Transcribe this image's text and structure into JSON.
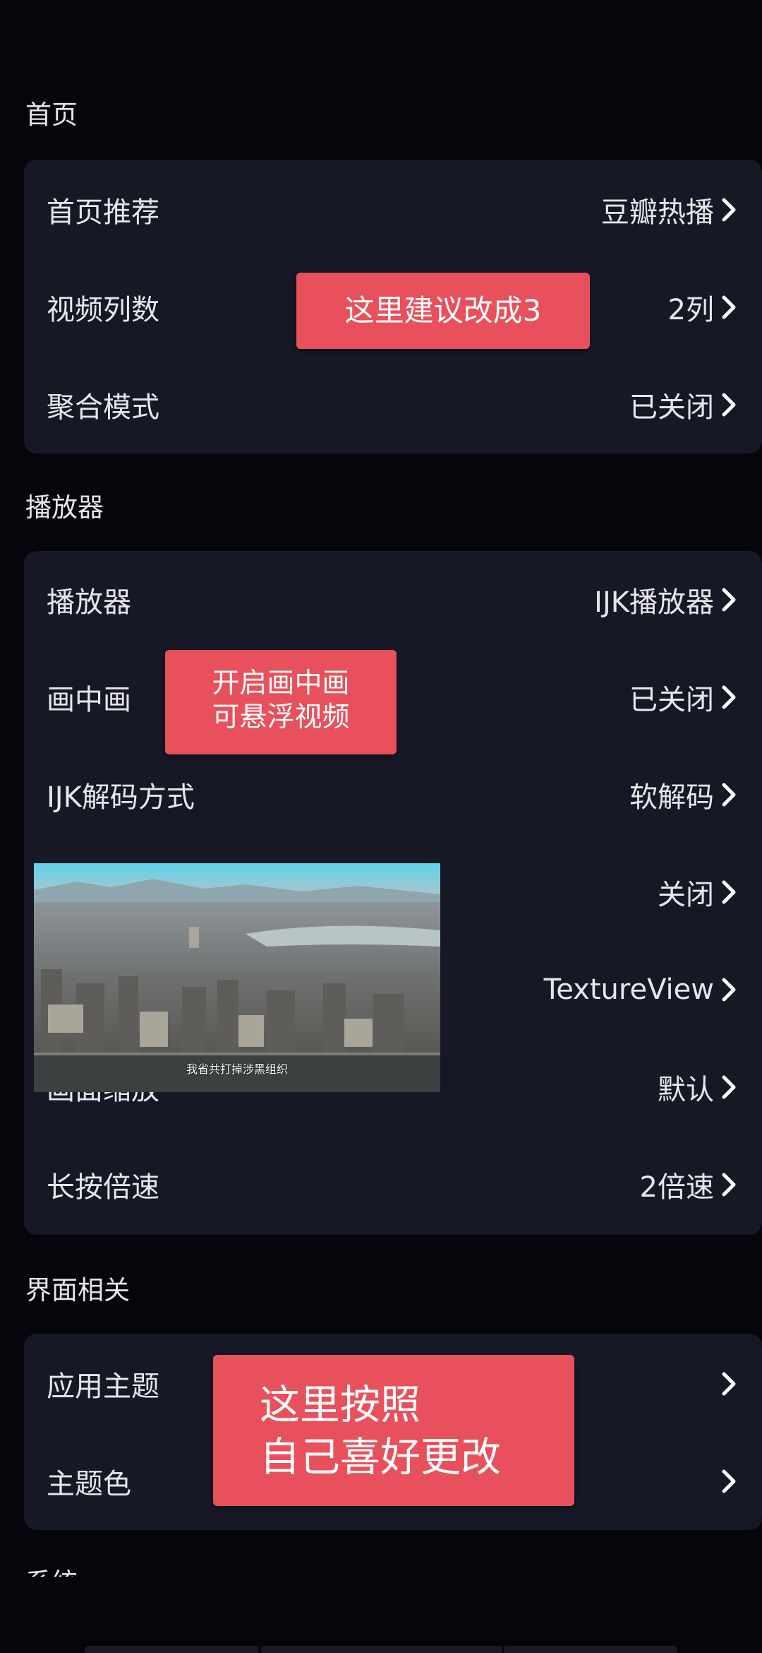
{
  "sections": {
    "home": {
      "title": "首页",
      "rows": [
        {
          "label": "首页推荐",
          "value": "豆瓣热播"
        },
        {
          "label": "视频列数",
          "value": "2列"
        },
        {
          "label": "聚合模式",
          "value": "已关闭"
        }
      ]
    },
    "player": {
      "title": "播放器",
      "rows": [
        {
          "label": "播放器",
          "value": "IJK播放器"
        },
        {
          "label": "画中画",
          "value": "已关闭"
        },
        {
          "label": "IJK解码方式",
          "value": "软解码"
        },
        {
          "label": "",
          "value": "关闭"
        },
        {
          "label": "",
          "value": "TextureView"
        },
        {
          "label": "画面缩放",
          "value": "默认"
        },
        {
          "label": "长按倍速",
          "value": "2倍速"
        }
      ]
    },
    "ui": {
      "title": "界面相关",
      "rows": [
        {
          "label": "应用主题",
          "value": ""
        },
        {
          "label": "主题色",
          "value": ""
        }
      ]
    },
    "system": {
      "title": "系统"
    }
  },
  "annotations": {
    "columns_tip": "这里建议改成3",
    "pip_tip_line1": "开启画中画",
    "pip_tip_line2": "可悬浮视频",
    "theme_tip_line1": "这里按照",
    "theme_tip_line2": "自己喜好更改"
  },
  "pip_video": {
    "subtitle": "我省共打掉涉黑组织"
  },
  "colors": {
    "background": "#06050b",
    "card": "#161925",
    "annotation": "#e8505b"
  },
  "icons": {
    "chevron": "chevron-right-icon"
  }
}
